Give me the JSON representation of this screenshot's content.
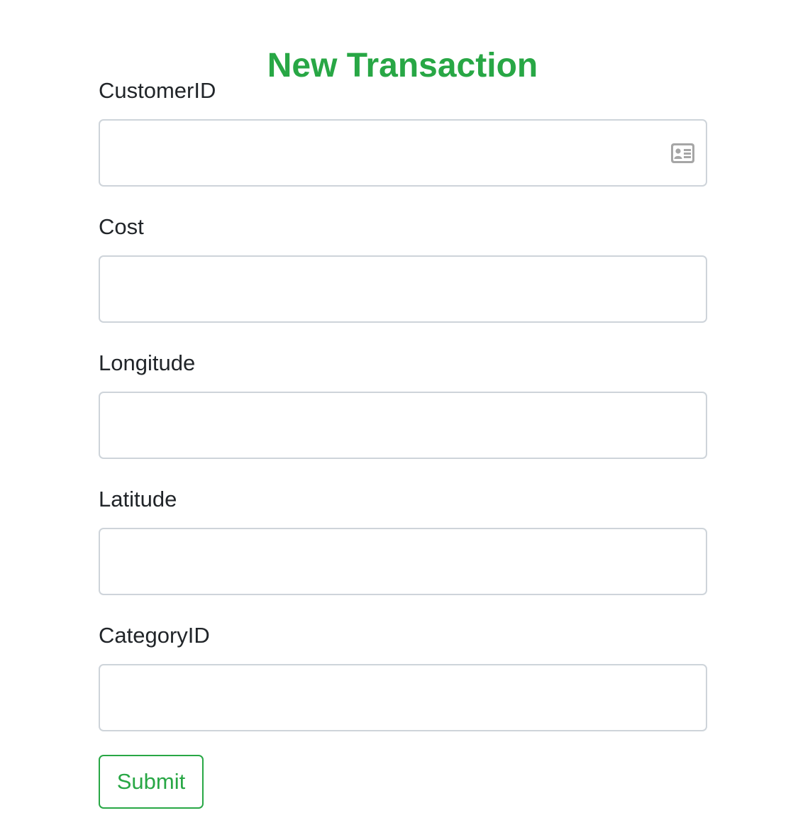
{
  "form": {
    "title": "New Transaction",
    "fields": [
      {
        "label": "CustomerID",
        "value": "",
        "placeholder": ""
      },
      {
        "label": "Cost",
        "value": "",
        "placeholder": ""
      },
      {
        "label": "Longitude",
        "value": "",
        "placeholder": ""
      },
      {
        "label": "Latitude",
        "value": "",
        "placeholder": ""
      },
      {
        "label": "CategoryID",
        "value": "",
        "placeholder": ""
      }
    ],
    "submit_label": "Submit"
  },
  "icons": {
    "customer_field_icon": "contact-card-icon"
  },
  "colors": {
    "accent": "#28a745",
    "text": "#212529",
    "border": "#ced4da",
    "icon": "#a6a6a6"
  }
}
